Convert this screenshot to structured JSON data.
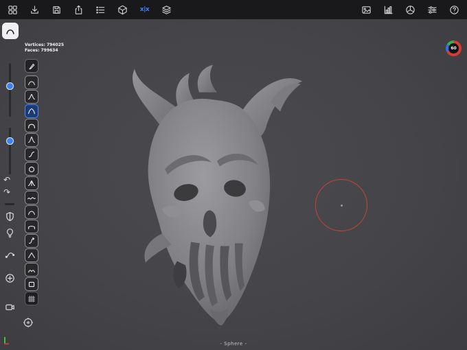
{
  "topbar": {
    "left_icons": [
      {
        "name": "apps-grid-icon"
      },
      {
        "name": "import-icon"
      },
      {
        "name": "save-icon"
      },
      {
        "name": "export-share-icon"
      },
      {
        "name": "scene-list-icon"
      },
      {
        "name": "mesh-cube-icon"
      },
      {
        "name": "symmetry-icon",
        "label": "x|x",
        "color": "#3a82f7"
      },
      {
        "name": "layers-icon"
      }
    ],
    "right_icons": [
      {
        "name": "background-image-icon"
      },
      {
        "name": "stats-chart-icon"
      },
      {
        "name": "material-sphere-icon"
      },
      {
        "name": "settings-sliders-icon"
      },
      {
        "name": "help-icon",
        "label": "?"
      }
    ]
  },
  "stats": {
    "vertices": "Vertices: 794025",
    "faces": "Faces: 799634"
  },
  "fps": {
    "value": "60",
    "ring_main": "#d63c31",
    "ring_secondary": "#2f6fe4",
    "ring_tertiary": "#35b34a"
  },
  "left_toolbar": {
    "undo_label": "↶",
    "redo_label": "↷",
    "sliders": [
      {
        "name": "brush-radius-slider"
      },
      {
        "name": "brush-intensity-slider"
      }
    ],
    "icons": [
      {
        "name": "mask-shield-icon"
      },
      {
        "name": "light-bulb-icon"
      },
      {
        "name": "smooth-curve-icon"
      },
      {
        "name": "add-circle-icon"
      },
      {
        "name": "camera-icon"
      }
    ]
  },
  "brush_column": {
    "selected_index": 2,
    "top_tool": {
      "name": "dropper-pen-tool"
    },
    "items": [
      {
        "name": "brush-clay",
        "glyph": "dome"
      },
      {
        "name": "brush-standard",
        "glyph": "peak"
      },
      {
        "name": "brush-build",
        "glyph": "dome2"
      },
      {
        "name": "brush-inflate",
        "glyph": "flatdome"
      },
      {
        "name": "brush-crease",
        "glyph": "spike"
      },
      {
        "name": "brush-move",
        "glyph": "scurve"
      },
      {
        "name": "brush-blob",
        "glyph": "circle"
      },
      {
        "name": "brush-pinch",
        "glyph": "pinch"
      },
      {
        "name": "brush-wave",
        "glyph": "wave"
      },
      {
        "name": "brush-smooth",
        "glyph": "dome"
      },
      {
        "name": "brush-flatten",
        "glyph": "flat"
      },
      {
        "name": "brush-drag",
        "glyph": "scurve2"
      },
      {
        "name": "brush-trim",
        "glyph": "peak2"
      },
      {
        "name": "brush-ridge",
        "glyph": "ridge"
      },
      {
        "name": "brush-stamp",
        "glyph": "square"
      },
      {
        "name": "grid-snapshot-tool",
        "glyph": "grid",
        "variant": "dark"
      }
    ]
  },
  "viewport": {
    "object_label": "- Sphere -"
  },
  "footer": {
    "gizmo": {
      "name": "gizmo-tool"
    }
  },
  "colors": {
    "accent_blue": "#3a82f7",
    "canvas_gray": "#454549",
    "topbar_black": "#19191b",
    "cursor_red": "#cd4137"
  }
}
